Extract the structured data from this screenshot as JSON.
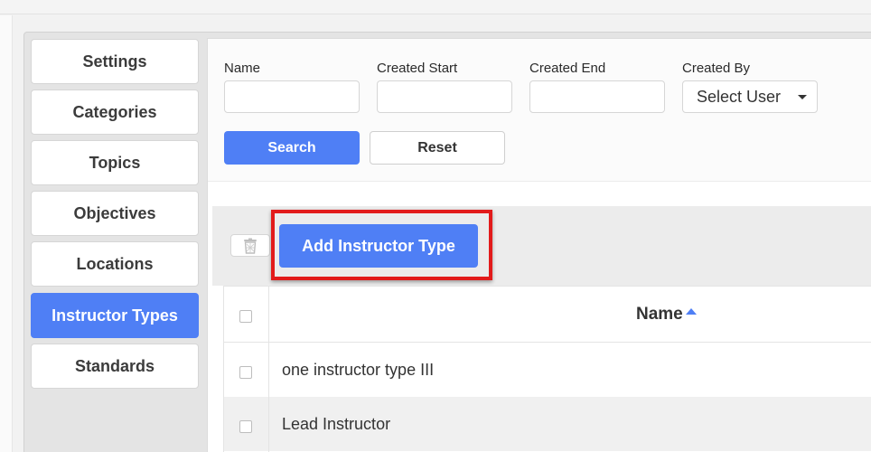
{
  "sidebar": {
    "items": [
      {
        "label": "Settings"
      },
      {
        "label": "Categories"
      },
      {
        "label": "Topics"
      },
      {
        "label": "Objectives"
      },
      {
        "label": "Locations"
      },
      {
        "label": "Instructor Types"
      },
      {
        "label": "Standards"
      }
    ],
    "active_index": 5
  },
  "filters": {
    "name_label": "Name",
    "name_value": "",
    "created_start_label": "Created Start",
    "created_start_value": "",
    "created_end_label": "Created End",
    "created_end_value": "",
    "created_by_label": "Created By",
    "created_by_value": "Select User",
    "search_label": "Search",
    "reset_label": "Reset"
  },
  "toolbar": {
    "add_label": "Add Instructor Type",
    "trash_icon": "trash-icon"
  },
  "table": {
    "header_name": "Name",
    "sort": "ascending",
    "rows": [
      {
        "name": "one instructor type III"
      },
      {
        "name": "Lead Instructor"
      }
    ]
  },
  "colors": {
    "accent": "#4f7ff5",
    "highlight": "#e21b1b"
  }
}
